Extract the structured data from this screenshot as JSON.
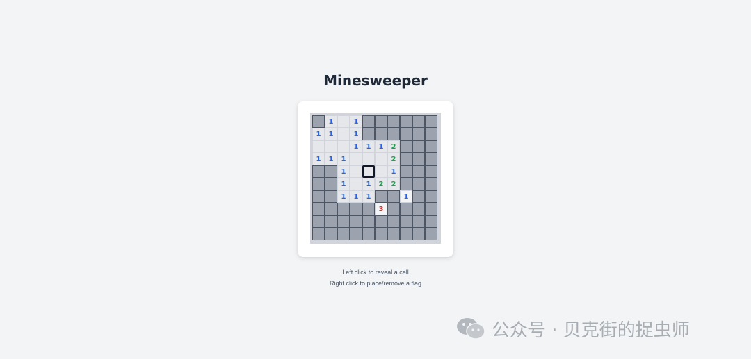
{
  "title": "Minesweeper",
  "instructions": {
    "line1": "Left click to reveal a cell",
    "line2": "Right click to place/remove a flag"
  },
  "colors": {
    "hidden": "#9ca3af",
    "revealed": "#e5e7eb",
    "n1": "#2563eb",
    "n2": "#16a34a",
    "n3": "#dc2626"
  },
  "board": {
    "rows": 10,
    "cols": 10,
    "legend": "H = hidden cell, 0 = revealed empty cell, digit = revealed number",
    "cells": [
      "H10 1HHHHHH",
      "110 1HHHHHH",
      "0001112HHH",
      "1110002HHH",
      "HH10001HHH",
      "HH1012 2HHH",
      "HH111HH1HH",
      "HHHHH3HHHH",
      "HHHHHHHHHH",
      "HHHHHHHHHH"
    ],
    "selected": {
      "row": 4,
      "col": 4
    },
    "light_cells": [
      [
        6,
        7
      ],
      [
        7,
        5
      ]
    ]
  },
  "watermark": "公众号 · 贝克街的捉虫师"
}
